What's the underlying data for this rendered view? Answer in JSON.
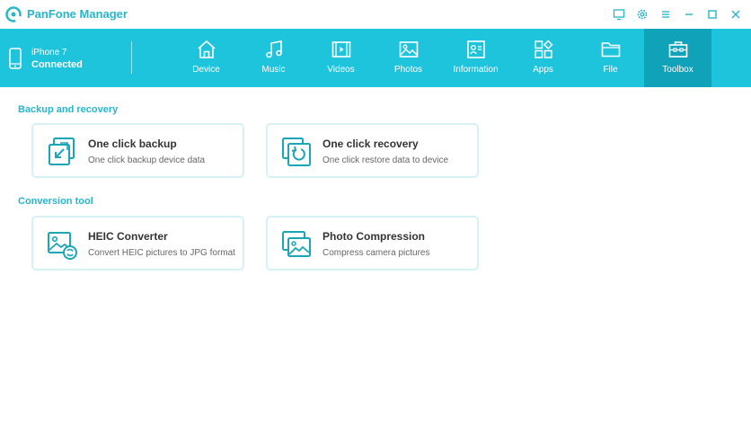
{
  "app": {
    "title": "PanFone Manager"
  },
  "window_controls": [
    {
      "name": "feedback-icon"
    },
    {
      "name": "gear-icon"
    },
    {
      "name": "menu-icon"
    },
    {
      "name": "minimize-icon"
    },
    {
      "name": "maximize-icon"
    },
    {
      "name": "close-icon"
    }
  ],
  "device": {
    "name": "iPhone 7",
    "status": "Connected"
  },
  "nav": {
    "items": [
      {
        "label": "Device",
        "icon": "home-icon",
        "active": false
      },
      {
        "label": "Music",
        "icon": "music-icon",
        "active": false
      },
      {
        "label": "Videos",
        "icon": "video-icon",
        "active": false
      },
      {
        "label": "Photos",
        "icon": "photo-icon",
        "active": false
      },
      {
        "label": "Information",
        "icon": "contact-card-icon",
        "active": false
      },
      {
        "label": "Apps",
        "icon": "apps-icon",
        "active": false
      },
      {
        "label": "File",
        "icon": "folder-icon",
        "active": false
      },
      {
        "label": "Toolbox",
        "icon": "toolbox-icon",
        "active": true
      }
    ]
  },
  "sections": {
    "backup": {
      "title": "Backup and recovery",
      "cards": [
        {
          "title": "One click backup",
          "desc": "One click backup device data",
          "icon": "backup-icon"
        },
        {
          "title": "One click recovery",
          "desc": "One click restore data to device",
          "icon": "recovery-icon"
        }
      ]
    },
    "conversion": {
      "title": "Conversion tool",
      "cards": [
        {
          "title": "HEIC Converter",
          "desc": "Convert HEIC pictures to JPG format",
          "icon": "heic-converter-icon"
        },
        {
          "title": "Photo Compression",
          "desc": "Compress camera pictures",
          "icon": "photo-compression-icon"
        }
      ]
    }
  },
  "colors": {
    "accent": "#1ec3dc",
    "active_tab": "#0fa2b9",
    "section_title": "#26b6cc",
    "card_border": "#d6f1f6"
  }
}
